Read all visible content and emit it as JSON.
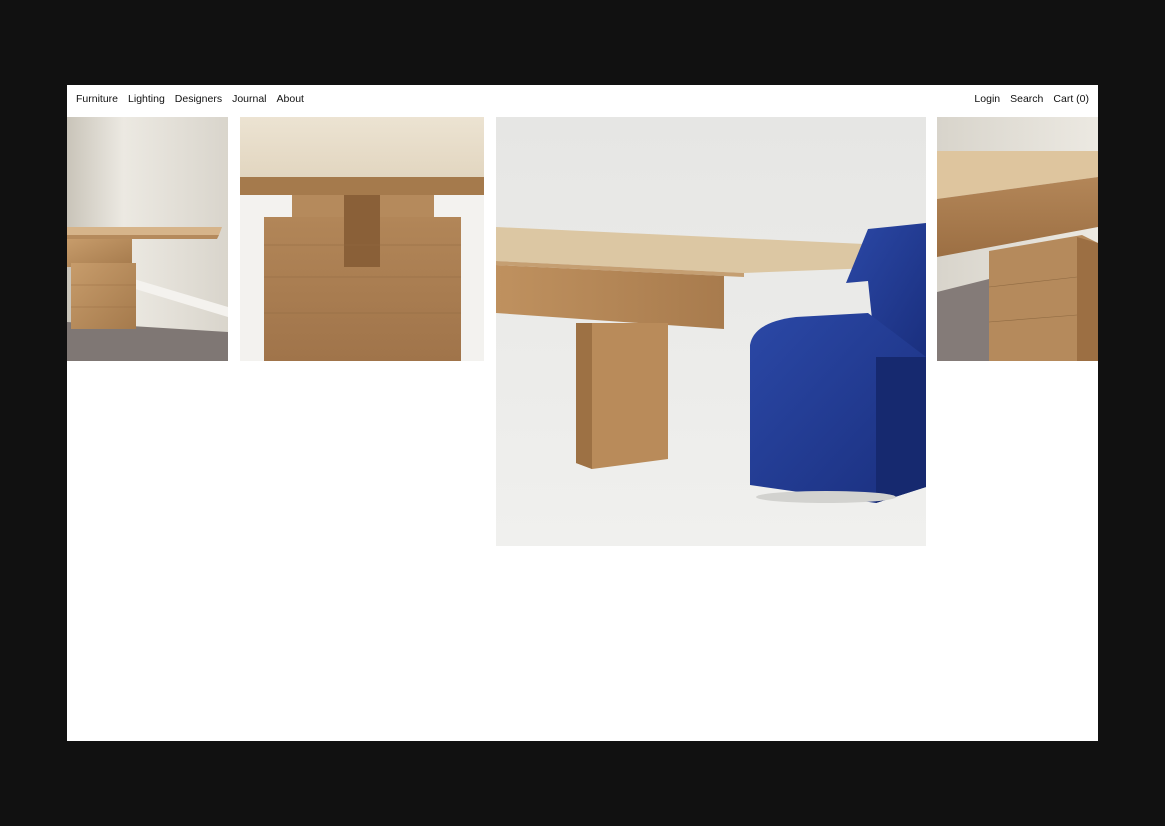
{
  "nav": {
    "left": [
      "Furniture",
      "Lighting",
      "Designers",
      "Journal",
      "About"
    ],
    "login": "Login",
    "search": "Search",
    "cart": "Cart (0)"
  },
  "gallery": {
    "images": [
      "table-corner-on-carpet",
      "table-leg-joint-closeup",
      "table-with-blue-chair",
      "table-edge-on-carpet"
    ]
  },
  "colors": {
    "page_background": "#111111",
    "frame_background": "#ffffff",
    "oak": "#b58a5c",
    "chair_blue": "#1f3a93"
  }
}
